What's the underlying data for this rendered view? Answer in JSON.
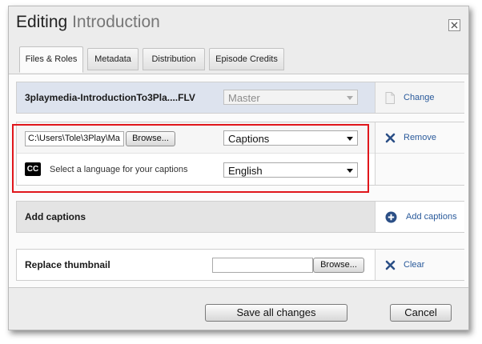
{
  "dialog": {
    "title_main": "Editing",
    "title_sub": "Introduction"
  },
  "tabs": [
    {
      "label": "Files & Roles",
      "active": true
    },
    {
      "label": "Metadata",
      "active": false
    },
    {
      "label": "Distribution",
      "active": false
    },
    {
      "label": "Episode Credits",
      "active": false
    }
  ],
  "master_row": {
    "filename": "3playmedia-IntroductionTo3Pla....FLV",
    "role_value": "Master",
    "action_label": "Change",
    "action_icon": "document-icon"
  },
  "captions_row": {
    "file_path": "C:\\Users\\Tole\\3Play\\Ma",
    "browse_label": "Browse...",
    "role_value": "Captions",
    "action_label": "Remove",
    "action_icon": "x-icon",
    "cc_icon_text": "CC",
    "language_prompt": "Select a language for your captions",
    "language_value": "English"
  },
  "add_row": {
    "label": "Add captions",
    "action_label": "Add captions",
    "action_icon": "plus-circle-icon"
  },
  "thumb_row": {
    "label": "Replace thumbnail",
    "file_value": "",
    "browse_label": "Browse...",
    "action_label": "Clear",
    "action_icon": "x-icon"
  },
  "footer": {
    "save_label": "Save all changes",
    "cancel_label": "Cancel"
  },
  "colors": {
    "link": "#2a5a9b",
    "highlight": "#e0161b",
    "master_row_bg": "#dde3ee"
  }
}
